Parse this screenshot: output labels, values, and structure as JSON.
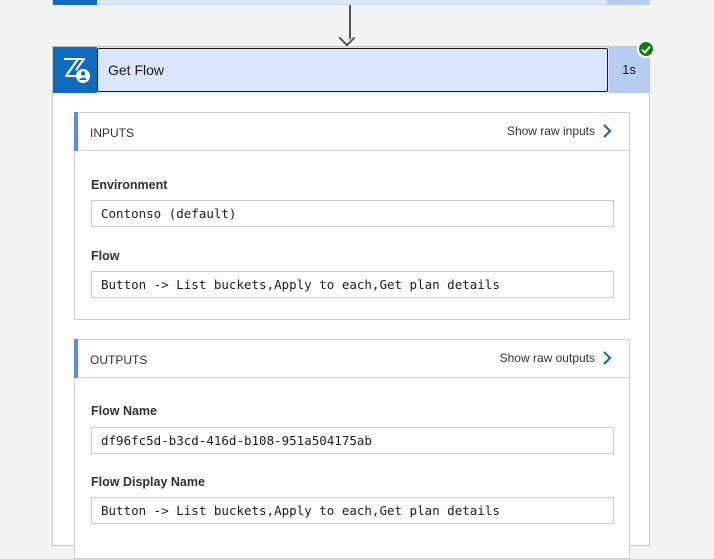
{
  "action": {
    "title": "Get Flow",
    "duration": "1s",
    "icon": "flow-management-icon",
    "status": "succeeded",
    "accent_color": "#0f6cbd",
    "success_color": "#107c10"
  },
  "inputs": {
    "title": "INPUTS",
    "raw_link": "Show raw inputs",
    "fields": [
      {
        "label": "Environment",
        "value": "Contonso (default)"
      },
      {
        "label": "Flow",
        "value": "Button -> List buckets,Apply to each,Get plan details"
      }
    ]
  },
  "outputs": {
    "title": "OUTPUTS",
    "raw_link": "Show raw outputs",
    "fields": [
      {
        "label": "Flow Name",
        "value": "df96fc5d-b3cd-416d-b108-951a504175ab"
      },
      {
        "label": "Flow Display Name",
        "value": "Button -> List buckets,Apply to each,Get plan details"
      }
    ]
  }
}
